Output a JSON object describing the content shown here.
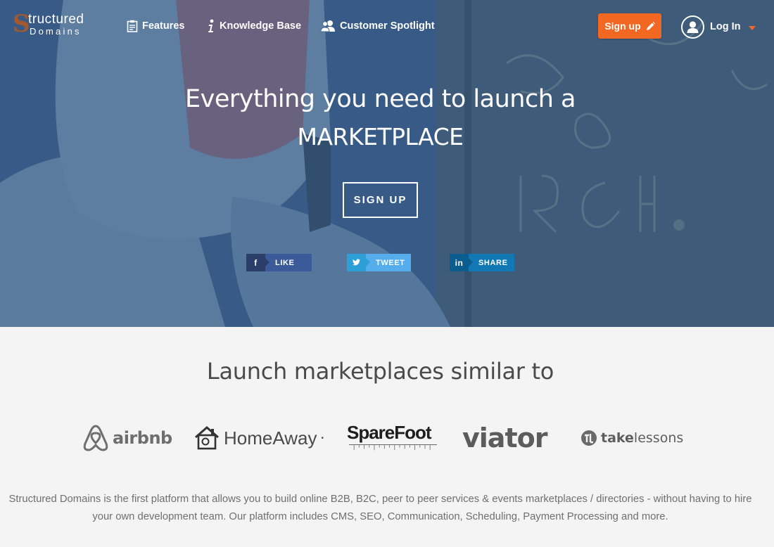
{
  "logo": {
    "initial": "S",
    "line1": "tructured",
    "line2": "Domains"
  },
  "nav": {
    "features": "Features",
    "knowledge_base": "Knowledge Base",
    "customer_spotlight": "Customer Spotlight",
    "signup": "Sign up",
    "login": "Log In"
  },
  "hero": {
    "headline_line1": "Everything you need to launch a",
    "headline_line2": "MARKETPLACE",
    "cta": "SIGN UP",
    "share": {
      "facebook_icon": "f",
      "facebook": "LIKE",
      "twitter": "TWEET",
      "linkedin_icon": "in",
      "linkedin": "SHARE"
    }
  },
  "similar": {
    "title": "Launch marketplaces similar to",
    "brands": {
      "airbnb": "airbnb",
      "homeaway": "HomeAway",
      "homeaway_mark": "•",
      "sparefoot": "SpareFoot",
      "viator": "viator",
      "takelessons_bold": "take",
      "takelessons_rest": "lessons"
    }
  },
  "description": "Structured Domains is the first platform that allows you to build online B2B, B2C, peer to peer services & events marketplaces / directories - without having to hire your own development team. Our platform includes CMS, SEO, Communication, Scheduling, Payment Processing and more.",
  "colors": {
    "accent": "#f26722",
    "hero_overlay": "#345c8a",
    "facebook": "#3b5a9a",
    "twitter": "#55aded",
    "linkedin": "#1278b3"
  },
  "icons": {
    "features": "clipboard-icon",
    "knowledge_base": "info-icon",
    "customer_spotlight": "users-icon",
    "signup": "pencil-icon",
    "login": "user-circle-icon"
  }
}
